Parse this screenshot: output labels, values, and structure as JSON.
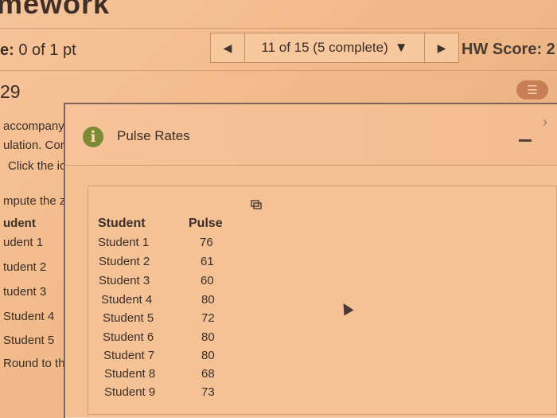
{
  "header": {
    "title": "mework"
  },
  "score": {
    "prefix": "e:",
    "value": "0 of 1 pt"
  },
  "navigation": {
    "position_text": "11 of 15 (5 complete)",
    "dropdown_icon": "caret-down-icon",
    "prev_icon": "prev-arrow-icon",
    "next_icon": "next-arrow-icon"
  },
  "homework": {
    "score_label": "HW Score: 2"
  },
  "question": {
    "number": "29",
    "menu_icon": "list-menu-icon"
  },
  "left_panel": {
    "fragments": [
      "accompany",
      "ulation. Cor",
      "Click the ic",
      "mpute the z-",
      "udent",
      "udent 1",
      "tudent 2",
      "tudent 3",
      "Student 4",
      "Student 5",
      "Round to the n"
    ]
  },
  "dialog": {
    "title": "Pulse Rates",
    "info_icon": "info-icon",
    "minimize_icon": "minimize-icon",
    "close_icon": "close-icon",
    "copy_icon": "copy-icon",
    "table": {
      "headers": {
        "student": "Student",
        "pulse": "Pulse"
      },
      "rows": [
        {
          "student": "Student 1",
          "pulse": "76"
        },
        {
          "student": "Student 2",
          "pulse": "61"
        },
        {
          "student": "Student 3",
          "pulse": "60"
        },
        {
          "student": "Student 4",
          "pulse": "80"
        },
        {
          "student": "Student 5",
          "pulse": "72"
        },
        {
          "student": "Student 6",
          "pulse": "80"
        },
        {
          "student": "Student 7",
          "pulse": "80"
        },
        {
          "student": "Student 8",
          "pulse": "68"
        },
        {
          "student": "Student 9",
          "pulse": "73"
        }
      ]
    }
  },
  "colors": {
    "background": "#f1b988",
    "panel": "#f5c296",
    "text": "#3b2e28",
    "accent": "#7d8a33"
  }
}
